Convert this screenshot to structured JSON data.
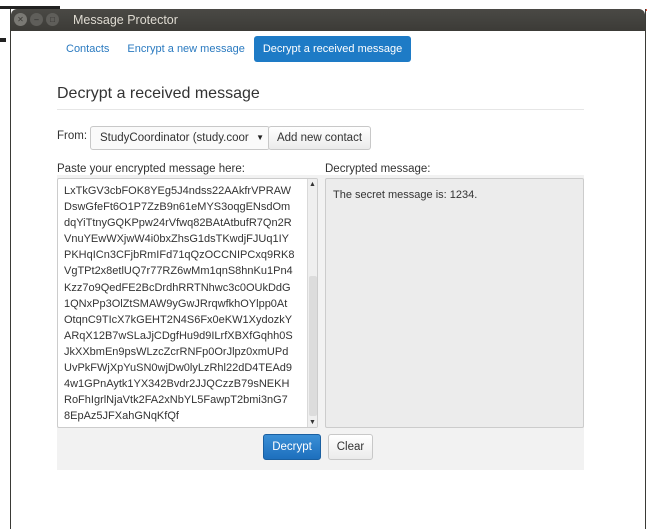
{
  "window": {
    "title": "Message Protector"
  },
  "tabs": [
    {
      "label": "Contacts",
      "active": false
    },
    {
      "label": "Encrypt a new message",
      "active": false
    },
    {
      "label": "Decrypt a received message",
      "active": true
    }
  ],
  "page": {
    "heading": "Decrypt a received message"
  },
  "form": {
    "from_label": "From:",
    "contact_selected": "StudyCoordinator (study.coor",
    "add_contact_label": "Add new contact",
    "encrypted_label": "Paste your encrypted message here:",
    "decrypted_label": "Decrypted message:",
    "encrypted_text": "LxTkGV3cbFOK8YEg5J4ndss22AAkfrVPRAW\nDswGfeFt6O1P7ZzB9n61eMYS3oqgENsdOm\ndqYiTtnyGQKPpw24rVfwq82BAtAtbufR7Qn2R\nVnuYEwWXjwW4i0bxZhsG1dsTKwdjFJUq1IY\nPKHqICn3CFjbRmIFd71qQzOCCNIPCxq9RK8\nVgTPt2x8etlUQ7r77RZ6wMm1qnS8hnKu1Pn4\nKzz7o9QedFE2BcDrdhRRTNhwc3c0OUkDdG\n1QNxPp3OlZtSMAW9yGwJRrqwfkhOYlpp0At\nOtqnC9TIcX7kGEHT2N4S6Fx0eKW1XydozkY\nARqX12B7wSLaJjCDgfHu9d9ILrfXBXfGqhh0S\nJkXXbmEn9psWLzcZcrRNFp0OrJlpz0xmUPd\nUvPkFWjXpYuSN0wjDw0lyLzRhl22dD4TEAd9\n4w1GPnAytk1YX342Bvdr2JJQCzzB79sNEKH\nRoFhIgrlNjaVtk2FA2xNbYL5FawpT2bmi3nG7\n8EpAz5JFXahGNqKfQf",
    "decrypted_text": "The secret message is: 1234.",
    "decrypt_label": "Decrypt",
    "clear_label": "Clear"
  },
  "icons": {
    "close": "close-icon",
    "minimize": "minimize-icon",
    "maximize": "maximize-icon",
    "dropdown": "chevron-down-icon"
  },
  "colors": {
    "accent": "#1e7bc6",
    "titlebar": "#3c3b37"
  }
}
